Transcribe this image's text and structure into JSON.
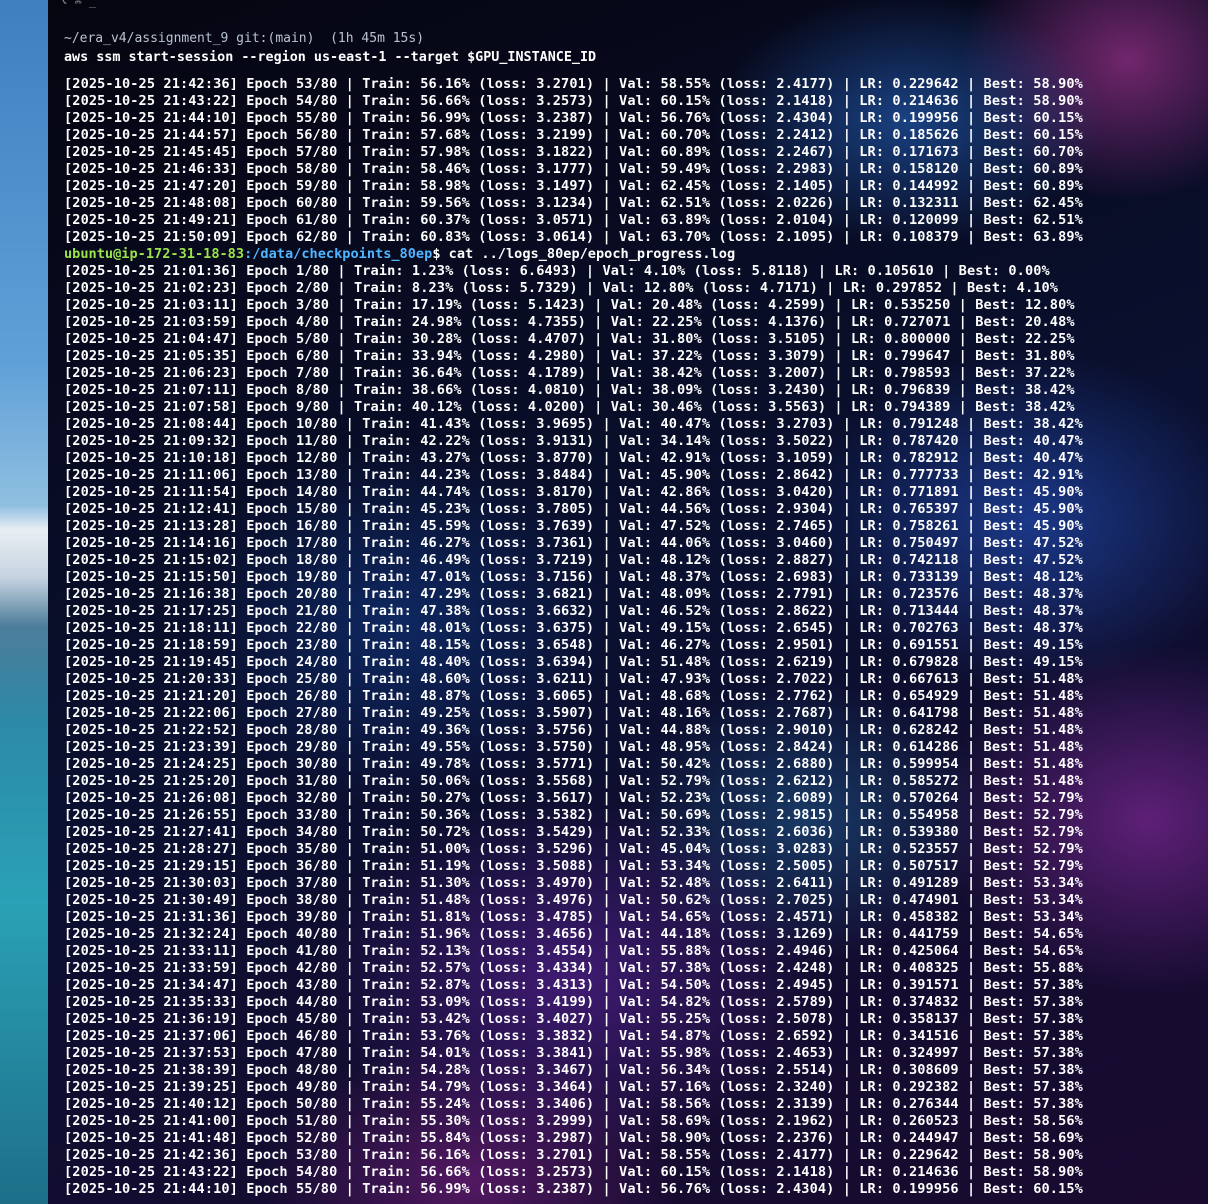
{
  "terminal": {
    "top_glyphs": "⌥ ⌘ _",
    "prompt_path": "~/era_v4/assignment_9 git:(main)  (1h 45m 15s)",
    "command": "aws ssm start-session --region us-east-1 --target $GPU_INSTANCE_ID",
    "shell_user": "ubuntu@ip-172-31-18-83",
    "shell_path": ":/data/checkpoints_80ep",
    "shell_command": "$ cat ../logs_80ep/epoch_progress.log",
    "log_block_1": [
      "[2025-10-25 21:42:36] Epoch 53/80 | Train: 56.16% (loss: 3.2701) | Val: 58.55% (loss: 2.4177) | LR: 0.229642 | Best: 58.90%",
      "[2025-10-25 21:43:22] Epoch 54/80 | Train: 56.66% (loss: 3.2573) | Val: 60.15% (loss: 2.1418) | LR: 0.214636 | Best: 58.90%",
      "[2025-10-25 21:44:10] Epoch 55/80 | Train: 56.99% (loss: 3.2387) | Val: 56.76% (loss: 2.4304) | LR: 0.199956 | Best: 60.15%",
      "[2025-10-25 21:44:57] Epoch 56/80 | Train: 57.68% (loss: 3.2199) | Val: 60.70% (loss: 2.2412) | LR: 0.185626 | Best: 60.15%",
      "[2025-10-25 21:45:45] Epoch 57/80 | Train: 57.98% (loss: 3.1822) | Val: 60.89% (loss: 2.2467) | LR: 0.171673 | Best: 60.70%",
      "[2025-10-25 21:46:33] Epoch 58/80 | Train: 58.46% (loss: 3.1777) | Val: 59.49% (loss: 2.2983) | LR: 0.158120 | Best: 60.89%",
      "[2025-10-25 21:47:20] Epoch 59/80 | Train: 58.98% (loss: 3.1497) | Val: 62.45% (loss: 2.1405) | LR: 0.144992 | Best: 60.89%",
      "[2025-10-25 21:48:08] Epoch 60/80 | Train: 59.56% (loss: 3.1234) | Val: 62.51% (loss: 2.0226) | LR: 0.132311 | Best: 62.45%",
      "[2025-10-25 21:49:21] Epoch 61/80 | Train: 60.37% (loss: 3.0571) | Val: 63.89% (loss: 2.0104) | LR: 0.120099 | Best: 62.51%",
      "[2025-10-25 21:50:09] Epoch 62/80 | Train: 60.83% (loss: 3.0614) | Val: 63.70% (loss: 2.1095) | LR: 0.108379 | Best: 63.89%"
    ],
    "log_block_2": [
      "[2025-10-25 21:01:36] Epoch 1/80 | Train: 1.23% (loss: 6.6493) | Val: 4.10% (loss: 5.8118) | LR: 0.105610 | Best: 0.00%",
      "[2025-10-25 21:02:23] Epoch 2/80 | Train: 8.23% (loss: 5.7329) | Val: 12.80% (loss: 4.7171) | LR: 0.297852 | Best: 4.10%",
      "[2025-10-25 21:03:11] Epoch 3/80 | Train: 17.19% (loss: 5.1423) | Val: 20.48% (loss: 4.2599) | LR: 0.535250 | Best: 12.80%",
      "[2025-10-25 21:03:59] Epoch 4/80 | Train: 24.98% (loss: 4.7355) | Val: 22.25% (loss: 4.1376) | LR: 0.727071 | Best: 20.48%",
      "[2025-10-25 21:04:47] Epoch 5/80 | Train: 30.28% (loss: 4.4707) | Val: 31.80% (loss: 3.5105) | LR: 0.800000 | Best: 22.25%",
      "[2025-10-25 21:05:35] Epoch 6/80 | Train: 33.94% (loss: 4.2980) | Val: 37.22% (loss: 3.3079) | LR: 0.799647 | Best: 31.80%",
      "[2025-10-25 21:06:23] Epoch 7/80 | Train: 36.64% (loss: 4.1789) | Val: 38.42% (loss: 3.2007) | LR: 0.798593 | Best: 37.22%",
      "[2025-10-25 21:07:11] Epoch 8/80 | Train: 38.66% (loss: 4.0810) | Val: 38.09% (loss: 3.2430) | LR: 0.796839 | Best: 38.42%",
      "[2025-10-25 21:07:58] Epoch 9/80 | Train: 40.12% (loss: 4.0200) | Val: 30.46% (loss: 3.5563) | LR: 0.794389 | Best: 38.42%",
      "[2025-10-25 21:08:44] Epoch 10/80 | Train: 41.43% (loss: 3.9695) | Val: 40.47% (loss: 3.2703) | LR: 0.791248 | Best: 38.42%",
      "[2025-10-25 21:09:32] Epoch 11/80 | Train: 42.22% (loss: 3.9131) | Val: 34.14% (loss: 3.5022) | LR: 0.787420 | Best: 40.47%",
      "[2025-10-25 21:10:18] Epoch 12/80 | Train: 43.27% (loss: 3.8770) | Val: 42.91% (loss: 3.1059) | LR: 0.782912 | Best: 40.47%",
      "[2025-10-25 21:11:06] Epoch 13/80 | Train: 44.23% (loss: 3.8484) | Val: 45.90% (loss: 2.8642) | LR: 0.777733 | Best: 42.91%",
      "[2025-10-25 21:11:54] Epoch 14/80 | Train: 44.74% (loss: 3.8170) | Val: 42.86% (loss: 3.0420) | LR: 0.771891 | Best: 45.90%",
      "[2025-10-25 21:12:41] Epoch 15/80 | Train: 45.23% (loss: 3.7805) | Val: 44.56% (loss: 2.9304) | LR: 0.765397 | Best: 45.90%",
      "[2025-10-25 21:13:28] Epoch 16/80 | Train: 45.59% (loss: 3.7639) | Val: 47.52% (loss: 2.7465) | LR: 0.758261 | Best: 45.90%",
      "[2025-10-25 21:14:16] Epoch 17/80 | Train: 46.27% (loss: 3.7361) | Val: 44.06% (loss: 3.0460) | LR: 0.750497 | Best: 47.52%",
      "[2025-10-25 21:15:02] Epoch 18/80 | Train: 46.49% (loss: 3.7219) | Val: 48.12% (loss: 2.8827) | LR: 0.742118 | Best: 47.52%",
      "[2025-10-25 21:15:50] Epoch 19/80 | Train: 47.01% (loss: 3.7156) | Val: 48.37% (loss: 2.6983) | LR: 0.733139 | Best: 48.12%",
      "[2025-10-25 21:16:38] Epoch 20/80 | Train: 47.29% (loss: 3.6821) | Val: 48.09% (loss: 2.7791) | LR: 0.723576 | Best: 48.37%",
      "[2025-10-25 21:17:25] Epoch 21/80 | Train: 47.38% (loss: 3.6632) | Val: 46.52% (loss: 2.8622) | LR: 0.713444 | Best: 48.37%",
      "[2025-10-25 21:18:11] Epoch 22/80 | Train: 48.01% (loss: 3.6375) | Val: 49.15% (loss: 2.6545) | LR: 0.702763 | Best: 48.37%",
      "[2025-10-25 21:18:59] Epoch 23/80 | Train: 48.15% (loss: 3.6548) | Val: 46.27% (loss: 2.9501) | LR: 0.691551 | Best: 49.15%",
      "[2025-10-25 21:19:45] Epoch 24/80 | Train: 48.40% (loss: 3.6394) | Val: 51.48% (loss: 2.6219) | LR: 0.679828 | Best: 49.15%",
      "[2025-10-25 21:20:33] Epoch 25/80 | Train: 48.60% (loss: 3.6211) | Val: 47.93% (loss: 2.7022) | LR: 0.667613 | Best: 51.48%",
      "[2025-10-25 21:21:20] Epoch 26/80 | Train: 48.87% (loss: 3.6065) | Val: 48.68% (loss: 2.7762) | LR: 0.654929 | Best: 51.48%",
      "[2025-10-25 21:22:06] Epoch 27/80 | Train: 49.25% (loss: 3.5907) | Val: 48.16% (loss: 2.7687) | LR: 0.641798 | Best: 51.48%",
      "[2025-10-25 21:22:52] Epoch 28/80 | Train: 49.36% (loss: 3.5756) | Val: 44.88% (loss: 2.9010) | LR: 0.628242 | Best: 51.48%",
      "[2025-10-25 21:23:39] Epoch 29/80 | Train: 49.55% (loss: 3.5750) | Val: 48.95% (loss: 2.8424) | LR: 0.614286 | Best: 51.48%",
      "[2025-10-25 21:24:25] Epoch 30/80 | Train: 49.78% (loss: 3.5771) | Val: 50.42% (loss: 2.6880) | LR: 0.599954 | Best: 51.48%",
      "[2025-10-25 21:25:20] Epoch 31/80 | Train: 50.06% (loss: 3.5568) | Val: 52.79% (loss: 2.6212) | LR: 0.585272 | Best: 51.48%",
      "[2025-10-25 21:26:08] Epoch 32/80 | Train: 50.27% (loss: 3.5617) | Val: 52.23% (loss: 2.6089) | LR: 0.570264 | Best: 52.79%",
      "[2025-10-25 21:26:55] Epoch 33/80 | Train: 50.36% (loss: 3.5382) | Val: 50.69% (loss: 2.9815) | LR: 0.554958 | Best: 52.79%",
      "[2025-10-25 21:27:41] Epoch 34/80 | Train: 50.72% (loss: 3.5429) | Val: 52.33% (loss: 2.6036) | LR: 0.539380 | Best: 52.79%",
      "[2025-10-25 21:28:27] Epoch 35/80 | Train: 51.00% (loss: 3.5296) | Val: 45.04% (loss: 3.0283) | LR: 0.523557 | Best: 52.79%",
      "[2025-10-25 21:29:15] Epoch 36/80 | Train: 51.19% (loss: 3.5088) | Val: 53.34% (loss: 2.5005) | LR: 0.507517 | Best: 52.79%",
      "[2025-10-25 21:30:03] Epoch 37/80 | Train: 51.30% (loss: 3.4970) | Val: 52.48% (loss: 2.6411) | LR: 0.491289 | Best: 53.34%",
      "[2025-10-25 21:30:49] Epoch 38/80 | Train: 51.48% (loss: 3.4976) | Val: 50.62% (loss: 2.7025) | LR: 0.474901 | Best: 53.34%",
      "[2025-10-25 21:31:36] Epoch 39/80 | Train: 51.81% (loss: 3.4785) | Val: 54.65% (loss: 2.4571) | LR: 0.458382 | Best: 53.34%",
      "[2025-10-25 21:32:24] Epoch 40/80 | Train: 51.96% (loss: 3.4656) | Val: 44.18% (loss: 3.1269) | LR: 0.441759 | Best: 54.65%",
      "[2025-10-25 21:33:11] Epoch 41/80 | Train: 52.13% (loss: 3.4554) | Val: 55.88% (loss: 2.4946) | LR: 0.425064 | Best: 54.65%",
      "[2025-10-25 21:33:59] Epoch 42/80 | Train: 52.57% (loss: 3.4334) | Val: 57.38% (loss: 2.4248) | LR: 0.408325 | Best: 55.88%",
      "[2025-10-25 21:34:47] Epoch 43/80 | Train: 52.87% (loss: 3.4313) | Val: 54.50% (loss: 2.4945) | LR: 0.391571 | Best: 57.38%",
      "[2025-10-25 21:35:33] Epoch 44/80 | Train: 53.09% (loss: 3.4199) | Val: 54.82% (loss: 2.5789) | LR: 0.374832 | Best: 57.38%",
      "[2025-10-25 21:36:19] Epoch 45/80 | Train: 53.42% (loss: 3.4027) | Val: 55.25% (loss: 2.5078) | LR: 0.358137 | Best: 57.38%",
      "[2025-10-25 21:37:06] Epoch 46/80 | Train: 53.76% (loss: 3.3832) | Val: 54.87% (loss: 2.6592) | LR: 0.341516 | Best: 57.38%",
      "[2025-10-25 21:37:53] Epoch 47/80 | Train: 54.01% (loss: 3.3841) | Val: 55.98% (loss: 2.4653) | LR: 0.324997 | Best: 57.38%",
      "[2025-10-25 21:38:39] Epoch 48/80 | Train: 54.28% (loss: 3.3467) | Val: 56.34% (loss: 2.5514) | LR: 0.308609 | Best: 57.38%",
      "[2025-10-25 21:39:25] Epoch 49/80 | Train: 54.79% (loss: 3.3464) | Val: 57.16% (loss: 2.3240) | LR: 0.292382 | Best: 57.38%",
      "[2025-10-25 21:40:12] Epoch 50/80 | Train: 55.24% (loss: 3.3406) | Val: 58.56% (loss: 2.3139) | LR: 0.276344 | Best: 57.38%",
      "[2025-10-25 21:41:00] Epoch 51/80 | Train: 55.30% (loss: 3.2999) | Val: 58.69% (loss: 2.1962) | LR: 0.260523 | Best: 58.56%",
      "[2025-10-25 21:41:48] Epoch 52/80 | Train: 55.84% (loss: 3.2987) | Val: 58.90% (loss: 2.2376) | LR: 0.244947 | Best: 58.69%",
      "[2025-10-25 21:42:36] Epoch 53/80 | Train: 56.16% (loss: 3.2701) | Val: 58.55% (loss: 2.4177) | LR: 0.229642 | Best: 58.90%",
      "[2025-10-25 21:43:22] Epoch 54/80 | Train: 56.66% (loss: 3.2573) | Val: 60.15% (loss: 2.1418) | LR: 0.214636 | Best: 58.90%",
      "[2025-10-25 21:44:10] Epoch 55/80 | Train: 56.99% (loss: 3.2387) | Val: 56.76% (loss: 2.4304) | LR: 0.199956 | Best: 60.15%"
    ]
  }
}
